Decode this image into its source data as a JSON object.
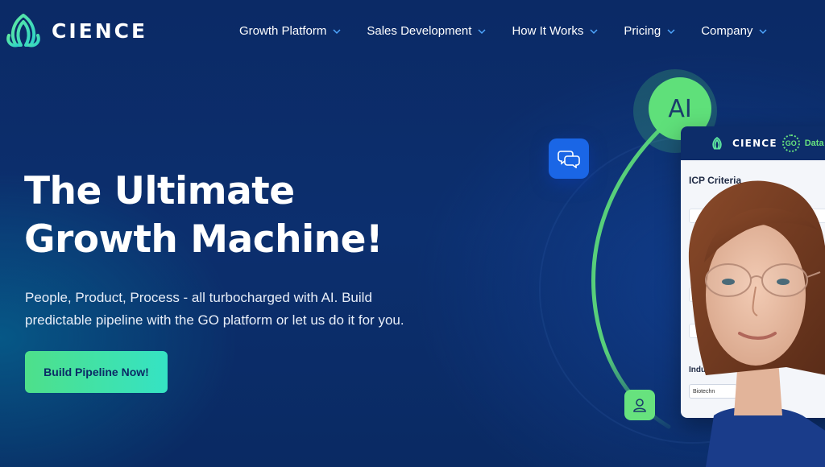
{
  "brand": {
    "name": "CIENCE",
    "logo_icon": "cience-leaf-icon",
    "accent": "#4ee08a",
    "bg": "#0b2a66"
  },
  "nav": {
    "items": [
      {
        "label": "Growth Platform"
      },
      {
        "label": "Sales Development"
      },
      {
        "label": "How It Works"
      },
      {
        "label": "Pricing"
      },
      {
        "label": "Company"
      }
    ]
  },
  "hero": {
    "title_line1": "The Ultimate",
    "title_line2": "Growth Machine!",
    "sub_line1": "People, Product, Process - all turbocharged with AI. Build",
    "sub_line2": "predictable pipeline with the GO platform or let us do it for you.",
    "cta_label": "Build Pipeline Now!"
  },
  "visual": {
    "ai_label": "AI",
    "chat_icon": "chat-bubbles-icon",
    "user_icon": "user-icon",
    "card": {
      "brand": "CIENCE",
      "go": "GO",
      "data": "Data",
      "section": "ICP Criteria",
      "industry_label": "Indus",
      "industry_chip": "Biotechn"
    }
  }
}
